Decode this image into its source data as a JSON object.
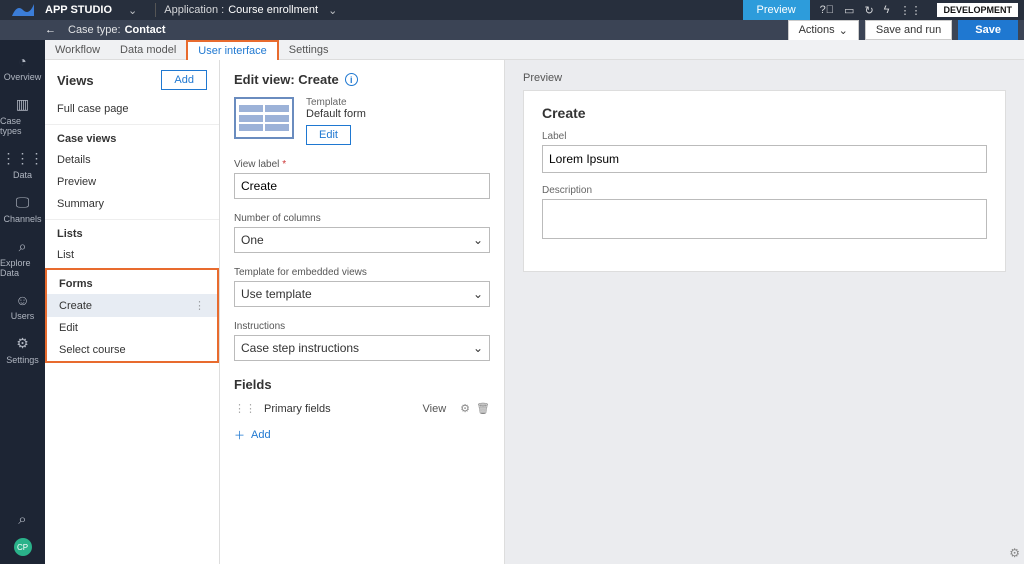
{
  "topbar": {
    "app_studio": "APP STUDIO",
    "app_label": "Application :",
    "app_name": "Course enrollment",
    "preview": "Preview",
    "env": "DEVELOPMENT"
  },
  "secondbar": {
    "case_type_label": "Case type:",
    "case_type_name": "Contact",
    "actions": "Actions",
    "save_run": "Save and run",
    "save": "Save"
  },
  "leftrail": {
    "items": [
      {
        "icon": "◔",
        "label": "Overview"
      },
      {
        "icon": "▥",
        "label": "Case types"
      },
      {
        "icon": "⋮⋮⋮",
        "label": "Data"
      },
      {
        "icon": "🖵",
        "label": "Channels"
      },
      {
        "icon": "⌕",
        "label": "Explore Data"
      },
      {
        "icon": "☺",
        "label": "Users"
      },
      {
        "icon": "⚙",
        "label": "Settings"
      }
    ],
    "avatar": "CP"
  },
  "tabs": [
    {
      "label": "Workflow"
    },
    {
      "label": "Data model"
    },
    {
      "label": "User interface"
    },
    {
      "label": "Settings"
    }
  ],
  "views": {
    "heading": "Views",
    "add": "Add",
    "full_case": "Full case page",
    "case_views_title": "Case views",
    "case_views": [
      "Details",
      "Preview",
      "Summary"
    ],
    "lists_title": "Lists",
    "lists": [
      "List"
    ],
    "forms_title": "Forms",
    "forms": [
      "Create",
      "Edit",
      "Select course"
    ]
  },
  "editor": {
    "title": "Edit view: Create",
    "template_label": "Template",
    "template_name": "Default form",
    "edit": "Edit",
    "view_label_label": "View label",
    "view_label_value": "Create",
    "num_cols_label": "Number of columns",
    "num_cols_value": "One",
    "tpl_embedded_label": "Template for embedded views",
    "tpl_embedded_value": "Use template",
    "instructions_label": "Instructions",
    "instructions_value": "Case step instructions",
    "fields_title": "Fields",
    "primary_fields": "Primary fields",
    "view_link": "View",
    "add": "Add"
  },
  "preview": {
    "title": "Preview",
    "panel_title": "Create",
    "label_label": "Label",
    "label_value": "Lorem Ipsum",
    "description_label": "Description"
  }
}
